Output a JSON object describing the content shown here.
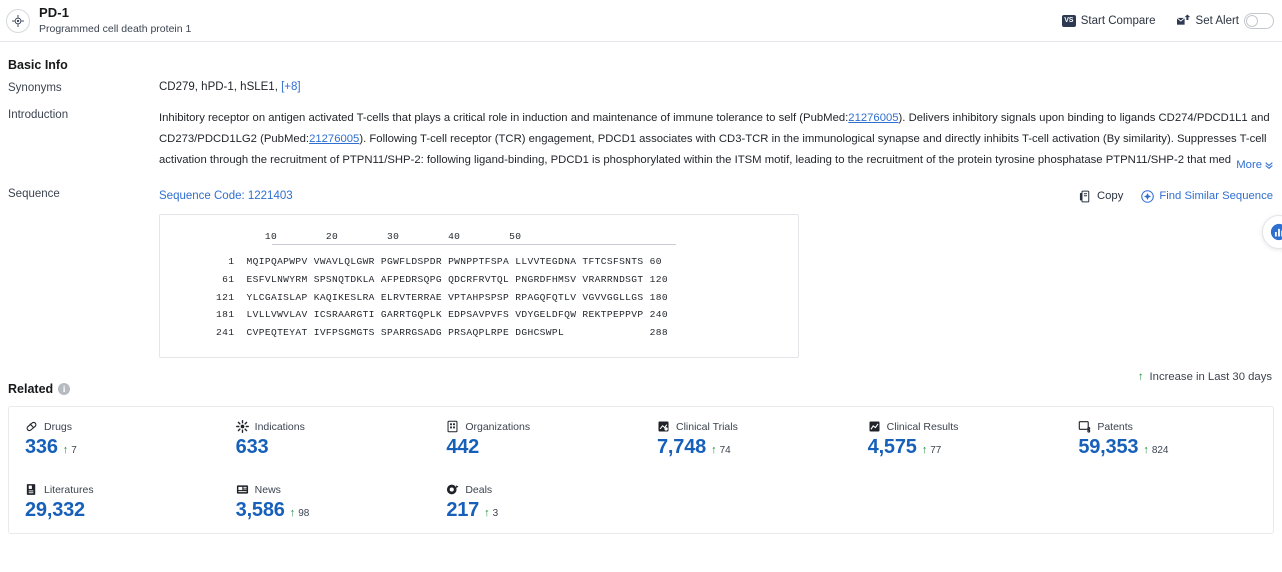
{
  "header": {
    "entity_name": "PD-1",
    "entity_subtitle": "Programmed cell death protein 1",
    "avatar_icon": "target-icon",
    "compare": {
      "label": "Start Compare",
      "badge": "VS",
      "icon": "vs-icon"
    },
    "alert": {
      "label": "Set Alert",
      "icon": "alert-bell-icon",
      "toggle_state": "off"
    }
  },
  "basic_info": {
    "title": "Basic Info",
    "synonyms": {
      "label": "Synonyms",
      "value": "CD279, hPD-1, hSLE1,",
      "more_label": "[+8]"
    },
    "introduction": {
      "label": "Introduction",
      "part1": "Inhibitory receptor on antigen activated T-cells that plays a critical role in induction and maintenance of immune tolerance to self (PubMed:",
      "link1": "21276005",
      "part2": "). Delivers inhibitory signals upon binding to ligands CD274/PDCD1L1 and CD273/PDCD1LG2 (PubMed:",
      "link2": "21276005",
      "part3": "). Following T-cell receptor (TCR) engagement, PDCD1 associates with CD3-TCR in the immunological synapse and directly inhibits T-cell activation (By similarity). Suppresses T-cell activation through the recruitment of PTPN11/SHP-2: following ligand-binding, PDCD1 is phosphorylated within the ITSM motif, leading to the recruitment of the protein tyrosine phosphatase PTPN11/SHP-2 that med",
      "more_label": "More",
      "more_icon": "chevron-down-icon"
    }
  },
  "sequence": {
    "label": "Sequence",
    "code_label": "Sequence Code: 1221403",
    "copy_label": "Copy",
    "copy_icon": "copy-icon",
    "find_similar_label": "Find Similar Sequence",
    "find_similar_icon": "find-similar-icon",
    "ruler": "        10        20        30        40        50",
    "lines": [
      {
        "start": "1",
        "blocks": "MQIPQAPWPV VWAVLQLGWR PGWFLDSPDR PWNPPTFSPA LLVVTEGDNA TFTCSFSNTS",
        "end": "60"
      },
      {
        "start": "61",
        "blocks": "ESFVLNWYRM SPSNQTDKLA AFPEDRSQPG QDCRFRVTQL PNGRDFHMSV VRARRNDSGT",
        "end": "120"
      },
      {
        "start": "121",
        "blocks": "YLCGAISLAP KAQIKESLRA ELRVTERRAE VPTAHPSPSP RPAGQFQTLV VGVVGGLLGS",
        "end": "180"
      },
      {
        "start": "181",
        "blocks": "LVLLVWVLAV ICSRAARGTI GARRTGQPLK EDPSAVPVFS VDYGELDFQW REKTPEPPVP",
        "end": "240"
      },
      {
        "start": "241",
        "blocks": "CVPEQTEYAT IVFPSGMGTS SPARRGSADG PRSAQPLRPE DGHCSWPL",
        "end": "288"
      }
    ]
  },
  "related": {
    "title": "Related",
    "info_icon": "info-icon",
    "legend": "Increase in Last 30 days",
    "legend_icon": "up-arrow-icon",
    "cards": [
      {
        "icon": "drug-pill-icon",
        "label": "Drugs",
        "value": "336",
        "delta": "7"
      },
      {
        "icon": "indications-icon",
        "label": "Indications",
        "value": "633",
        "delta": ""
      },
      {
        "icon": "organizations-icon",
        "label": "Organizations",
        "value": "442",
        "delta": ""
      },
      {
        "icon": "clinical-trials-icon",
        "label": "Clinical Trials",
        "value": "7,748",
        "delta": "74"
      },
      {
        "icon": "clinical-results-icon",
        "label": "Clinical Results",
        "value": "4,575",
        "delta": "77"
      },
      {
        "icon": "patents-icon",
        "label": "Patents",
        "value": "59,353",
        "delta": "824"
      },
      {
        "icon": "literatures-icon",
        "label": "Literatures",
        "value": "29,332",
        "delta": ""
      },
      {
        "icon": "news-icon",
        "label": "News",
        "value": "3,586",
        "delta": "98"
      },
      {
        "icon": "deals-icon",
        "label": "Deals",
        "value": "217",
        "delta": "3"
      }
    ]
  },
  "floating_widget": {
    "icon": "chart-bubble-icon"
  },
  "colors": {
    "link_blue": "#2f6fd0",
    "stat_blue": "#1760ba",
    "increase_green": "#1f9341",
    "border_grey": "#e3e5e9",
    "text_primary": "#1f2329"
  }
}
